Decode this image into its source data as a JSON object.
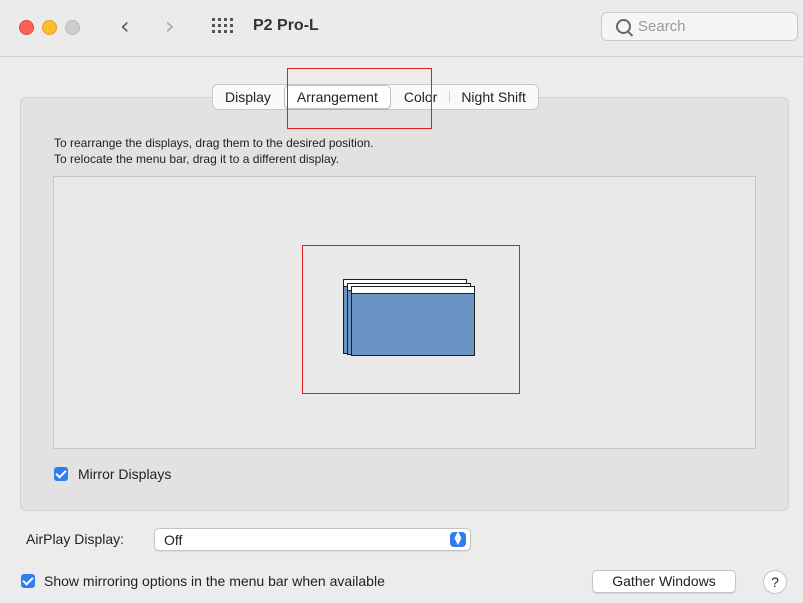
{
  "window": {
    "title": "P2 Pro-L"
  },
  "search": {
    "placeholder": "Search"
  },
  "tabs": [
    {
      "label": "Display"
    },
    {
      "label": "Arrangement",
      "selected": true
    },
    {
      "label": "Color"
    },
    {
      "label": "Night Shift"
    }
  ],
  "instructions": {
    "line1": "To rearrange the displays, drag them to the desired position.",
    "line2": "To relocate the menu bar, drag it to a different display."
  },
  "mirror": {
    "label": "Mirror Displays",
    "checked": true
  },
  "airplay": {
    "label": "AirPlay Display:",
    "value": "Off"
  },
  "show_mirroring": {
    "label": "Show mirroring options in the menu bar when available",
    "checked": true
  },
  "gather_button": {
    "label": "Gather Windows"
  },
  "help": {
    "label": "?"
  },
  "colors": {
    "display_fill": "#6b94c4",
    "accent": "#2f7ef0",
    "highlight_box": "#e02020"
  }
}
